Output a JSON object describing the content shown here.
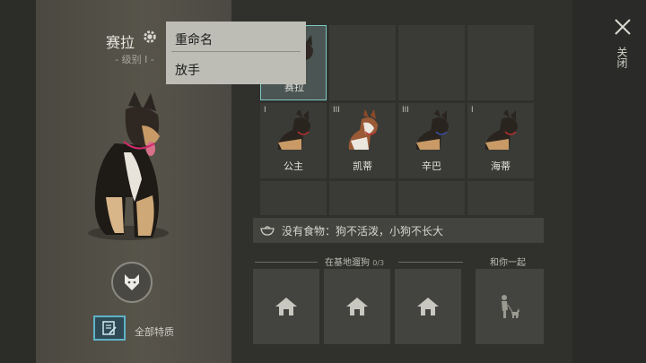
{
  "dog": {
    "name": "赛拉",
    "level": "- 级别 I -"
  },
  "context_menu": {
    "items": [
      "重命名",
      "放手"
    ]
  },
  "traits": {
    "all_traits_label": "全部特质"
  },
  "dog_grid": [
    {
      "name": "赛拉",
      "level": "",
      "selected": true
    },
    {
      "name": "",
      "level": ""
    },
    {
      "name": "",
      "level": ""
    },
    {
      "name": "",
      "level": ""
    },
    {
      "name": "公主",
      "level": "I"
    },
    {
      "name": "凯蒂",
      "level": "III"
    },
    {
      "name": "辛巴",
      "level": "III"
    },
    {
      "name": "海蒂",
      "level": "I"
    },
    {
      "name": "",
      "level": ""
    },
    {
      "name": "",
      "level": ""
    },
    {
      "name": "",
      "level": ""
    },
    {
      "name": "",
      "level": ""
    }
  ],
  "food_status": "没有食物：狗不活泼，小狗不长大",
  "base_walk": {
    "title": "在基地遛狗",
    "count": "0/3"
  },
  "with_you": {
    "title": "和你一起"
  },
  "close": {
    "label": "关闭"
  }
}
